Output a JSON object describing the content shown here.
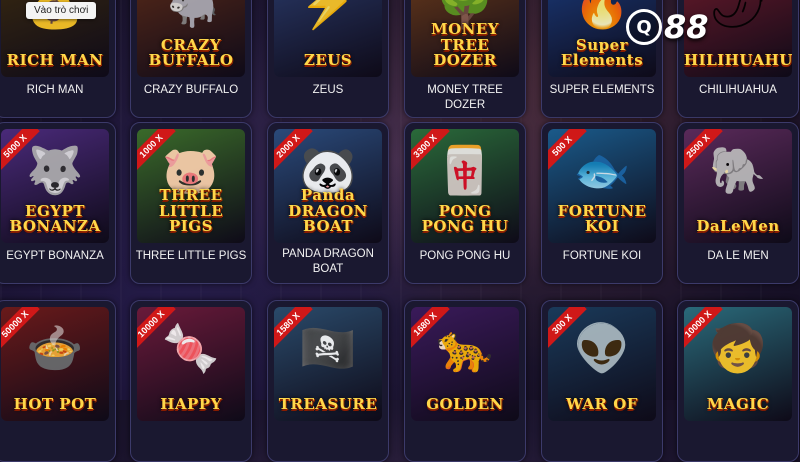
{
  "tooltip": "Vào trò chơi",
  "brand": {
    "badge": "Q",
    "num": "88",
    "accent": "#ffffff"
  },
  "games": [
    {
      "id": "rich-man",
      "name": "RICH MAN",
      "logo": "RICH MAN",
      "mult": "",
      "art": "💰",
      "bg": "#3a2a10",
      "icon": "coin-icon"
    },
    {
      "id": "crazy-buffalo",
      "name": "CRAZY BUFFALO",
      "logo": "CRAZY BUFFALO",
      "mult": "",
      "art": "🐃",
      "bg": "#5a2a18",
      "icon": "buffalo-icon"
    },
    {
      "id": "zeus",
      "name": "ZEUS",
      "logo": "ZEUS",
      "mult": "",
      "art": "⚡",
      "bg": "#2a3a6a",
      "icon": "lightning-icon"
    },
    {
      "id": "money-tree-dozer",
      "name": "MONEY TREE DOZER",
      "logo": "MONEY TREE DOZER",
      "mult": "",
      "art": "🌳",
      "bg": "#6a3a1a",
      "icon": "tree-icon"
    },
    {
      "id": "super-elements",
      "name": "SUPER ELEMENTS",
      "logo": "Super Elements",
      "mult": "",
      "art": "🔥",
      "bg": "#1a3a7a",
      "icon": "fire-icon"
    },
    {
      "id": "chilihuahua",
      "name": "CHILIHUAHUA",
      "logo": "CHILIHUAHUA",
      "mult": "",
      "art": "🌶",
      "bg": "#6a1a2a",
      "icon": "chili-icon"
    },
    {
      "id": "egypt-bonanza",
      "name": "EGYPT BONANZA",
      "logo": "EGYPT BONANZA",
      "mult": "5000 X",
      "art": "🐺",
      "bg": "#4a2a7a",
      "icon": "anubis-icon"
    },
    {
      "id": "three-little-pigs",
      "name": "THREE LITTLE PIGS",
      "logo": "THREE LITTLE PIGS",
      "mult": "1000 X",
      "art": "🐷",
      "bg": "#3a6a2a",
      "icon": "pig-icon"
    },
    {
      "id": "panda-dragon-boat",
      "name": "PANDA DRAGON BOAT",
      "logo": "Panda DRAGON BOAT",
      "mult": "2000 X",
      "art": "🐼",
      "bg": "#2a4a7a",
      "icon": "panda-icon"
    },
    {
      "id": "pong-pong-hu",
      "name": "PONG PONG HU",
      "logo": "PONG PONG HU",
      "mult": "3300 X",
      "art": "🀄",
      "bg": "#2a6a3a",
      "icon": "mahjong-icon"
    },
    {
      "id": "fortune-koi",
      "name": "FORTUNE KOI",
      "logo": "FORTUNE KOI",
      "mult": "500 X",
      "art": "🐟",
      "bg": "#1a5a8a",
      "icon": "koi-icon"
    },
    {
      "id": "da-le-men",
      "name": "DA LE MEN",
      "logo": "DaLeMen",
      "mult": "2500 X",
      "art": "🐘",
      "bg": "#5a2a5a",
      "icon": "elephant-icon"
    },
    {
      "id": "hot-pot",
      "name": "",
      "logo": "HOT POT",
      "mult": "50000 X",
      "art": "🍲",
      "bg": "#6a1a1a",
      "icon": "hotpot-icon"
    },
    {
      "id": "happy",
      "name": "",
      "logo": "HAPPY",
      "mult": "10000 X",
      "art": "🍬",
      "bg": "#6a1a3a",
      "icon": "candy-icon"
    },
    {
      "id": "treasure",
      "name": "",
      "logo": "TREASURE",
      "mult": "1580 X",
      "art": "🏴‍☠️",
      "bg": "#2a4a6a",
      "icon": "pirate-icon"
    },
    {
      "id": "golden",
      "name": "",
      "logo": "GOLDEN",
      "mult": "1680 X",
      "art": "🐆",
      "bg": "#3a1a5a",
      "icon": "panther-icon"
    },
    {
      "id": "war-of",
      "name": "",
      "logo": "WAR OF",
      "mult": "300 X",
      "art": "👽",
      "bg": "#1a3a5a",
      "icon": "alien-icon"
    },
    {
      "id": "magic",
      "name": "",
      "logo": "MAGIC",
      "mult": "10000 X",
      "art": "🧒",
      "bg": "#2a6a7a",
      "icon": "boy-icon"
    }
  ]
}
